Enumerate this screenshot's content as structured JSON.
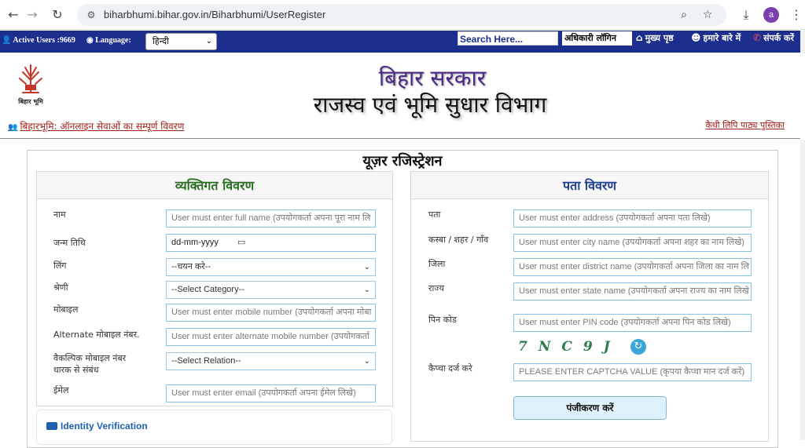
{
  "browser": {
    "url": "biharbhumi.bihar.gov.in/Biharbhumi/UserRegister",
    "avatar_letter": "a"
  },
  "topbar": {
    "active_users_label": "Active Users :",
    "active_users_count": "9669",
    "language_label": "Language:",
    "language_value": "हिन्दी",
    "search_placeholder": "Search Here...",
    "officer_login": "अधिकारी लॉगिन",
    "home": "मुख्य पृष्ठ",
    "about": "हमारे बारे में",
    "contact": "संपर्क करें"
  },
  "header": {
    "logo_text": "बिहार भूमि",
    "title1": "बिहार सरकार",
    "title2": "राजस्व एवं भूमि सुधार विभाग",
    "left_link": "बिहारभूमि: ऑनलाइन सेवाओं का सम्पूर्ण विवरण",
    "right_link": "कैथी लिपि पाठ्य पुस्तिका"
  },
  "form": {
    "title": "यूज़र रजिस्ट्रेशन",
    "personal": {
      "heading": "व्यक्तिगत विवरण",
      "name_label": "नाम",
      "name_placeholder": "User must enter full name (उपयोगकर्ता अपना पूरा नाम लि",
      "dob_label": "जन्म तिथि",
      "dob_value": "dd-mm-yyyy",
      "gender_label": "लिंग",
      "gender_value": "--चयन करे--",
      "category_label": "श्रेणी",
      "category_value": "--Select Category--",
      "mobile_label": "मोबाइल",
      "mobile_placeholder": "User must enter mobile number (उपयोगकर्ता अपना मोबा",
      "alt_mobile_label": "Alternate मोबाइल नंबर.",
      "alt_mobile_placeholder": "User must enter alternate mobile number (उपयोगकर्ता",
      "relation_label_line1": "वैकल्पिक मोबाइल नंबर",
      "relation_label_line2": "धारक से संबंध",
      "relation_value": "--Select Relation--",
      "email_label": "ईमेल",
      "email_placeholder": "User must enter email (उपयोगकर्ता अपना ईमेल लिखे)"
    },
    "address": {
      "heading": "पता विवरण",
      "address_label": "पता",
      "address_placeholder": "User must enter address (उपयोगकर्ता अपना पता लिखे)",
      "city_label": "कस्बा / शहर / गाँव",
      "city_placeholder": "User must enter city name (उपयोगकर्ता अपना शहर का नाम लिखे)",
      "district_label": "जिला",
      "district_placeholder": "User must enter district name (उपयोगकर्ता अपना जिला का नाम लि",
      "state_label": "राज्य",
      "state_placeholder": "User must enter state name (उपयोगकर्ता अपना राज्य का नाम लिखे",
      "pin_label": "पिन कोड",
      "pin_placeholder": "User must enter PIN code (उपयोगकर्ता अपना पिन कोड लिखे)",
      "captcha_text": "7NC9J",
      "captcha_label": "कैप्चा दर्ज करे",
      "captcha_placeholder": "PLEASE ENTER CAPTCHA VALUE (कृपया कैप्चा मान दर्ज करें)",
      "register_button": "पंजीकरण करें"
    },
    "identity_verification": "Identity Verification"
  }
}
